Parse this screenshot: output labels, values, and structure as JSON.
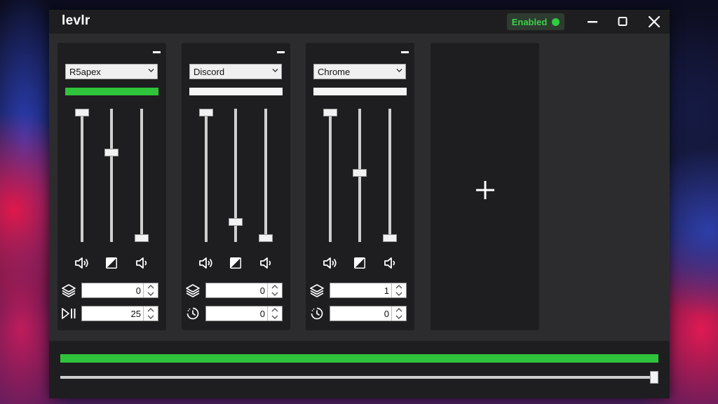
{
  "app": {
    "title": "levlr",
    "status_label": "Enabled",
    "status_color": "#2fcd3f"
  },
  "window_controls": [
    "minimize-icon",
    "maximize-icon",
    "close-icon"
  ],
  "panels": [
    {
      "app_name": "R5apex",
      "level_active": true,
      "sliders": {
        "volume": 1.0,
        "contrast": 0.68,
        "right": 0.0
      },
      "bottom_icons": [
        "speaker-icon",
        "contrast-icon",
        "speaker-quiet-icon"
      ],
      "field1": {
        "icon": "layers-icon",
        "value": "0"
      },
      "field2": {
        "icon": "play-pause-icon",
        "value": "25"
      }
    },
    {
      "app_name": "Discord",
      "level_active": false,
      "sliders": {
        "volume": 1.0,
        "contrast": 0.13,
        "right": 0.0
      },
      "bottom_icons": [
        "speaker-icon",
        "contrast-icon",
        "speaker-quiet-icon"
      ],
      "field1": {
        "icon": "layers-icon",
        "value": "0"
      },
      "field2": {
        "icon": "timer-icon",
        "value": "0"
      }
    },
    {
      "app_name": "Chrome",
      "level_active": false,
      "sliders": {
        "volume": 1.0,
        "contrast": 0.52,
        "right": 0.0
      },
      "bottom_icons": [
        "speaker-icon",
        "contrast-icon",
        "speaker-quiet-icon"
      ],
      "field1": {
        "icon": "layers-icon",
        "value": "1"
      },
      "field2": {
        "icon": "timer-icon",
        "value": "0"
      }
    }
  ],
  "add_panel": {
    "icon": "plus-icon"
  },
  "master": {
    "level": 1.0,
    "slider": 1.0
  },
  "colors": {
    "accent_green": "#2fc33c",
    "panel_bg": "#1e1e20",
    "window_bg": "#2c2c2e"
  }
}
